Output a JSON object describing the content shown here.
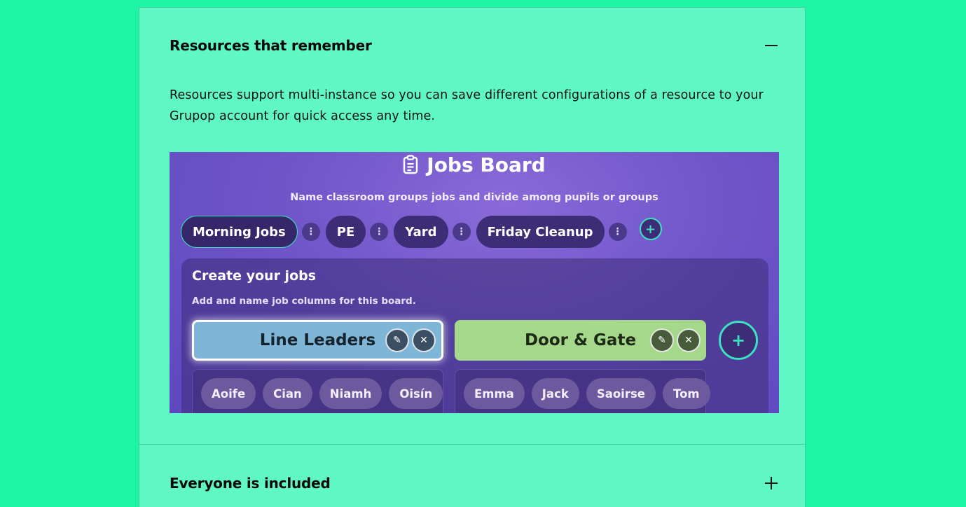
{
  "accordion": {
    "section1": {
      "title": "Resources that remember",
      "toggle_icon": "minus-icon",
      "body": "Resources support multi-instance so you can save different configurations of a resource to your Grupop account for quick access any time."
    },
    "section2": {
      "title": "Everyone is included",
      "toggle_icon": "plus-icon"
    }
  },
  "screenshot": {
    "title": "Jobs Board",
    "subtitle": "Name classroom groups jobs and divide among pupils or groups",
    "tabs": [
      "Morning Jobs",
      "PE",
      "Yard",
      "Friday Cleanup"
    ],
    "active_tab": "Morning Jobs",
    "panel": {
      "title": "Create your jobs",
      "subtitle": "Add and name job columns for this board.",
      "jobs": [
        {
          "name": "Line Leaders",
          "color": "#7fb6d8",
          "pupils": [
            "Aoife",
            "Cian",
            "Niamh",
            "Oisín"
          ]
        },
        {
          "name": "Door & Gate",
          "color": "#a6d88b",
          "pupils": [
            "Emma",
            "Jack",
            "Saoirse",
            "Tom"
          ]
        }
      ]
    },
    "colors": {
      "accent": "#3de0c0",
      "background": "#6f56c9"
    }
  },
  "colors": {
    "page_bg": "#1ef4a6",
    "card_bg": "#5ff7c3"
  }
}
